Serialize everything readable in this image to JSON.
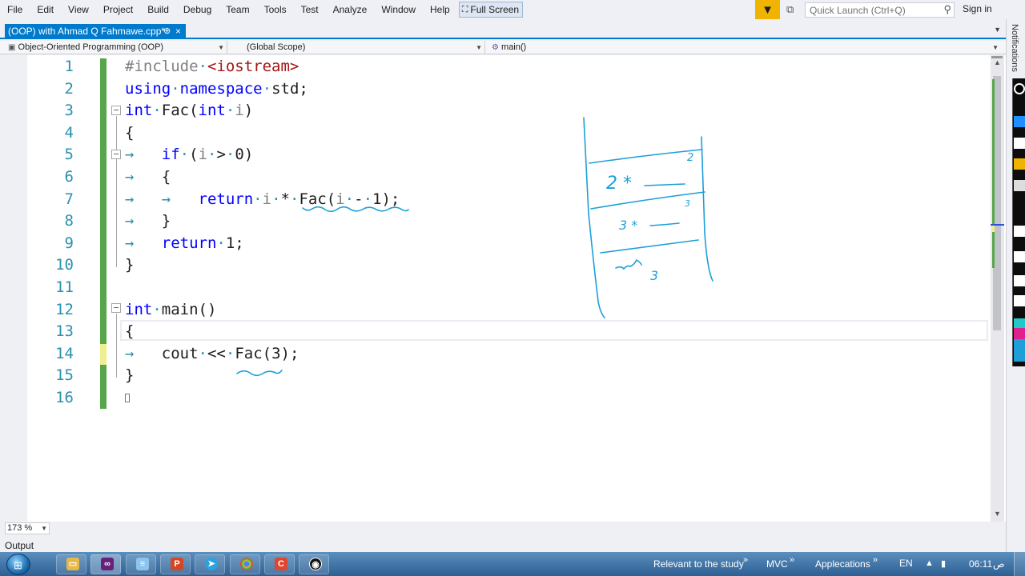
{
  "menu": {
    "items": [
      "File",
      "Edit",
      "View",
      "Project",
      "Build",
      "Debug",
      "Team",
      "Tools",
      "Test",
      "Analyze",
      "Window",
      "Help"
    ],
    "fullscreen_label": "Full Screen"
  },
  "quick_launch": {
    "placeholder": "Quick Launch (Ctrl+Q)"
  },
  "signin_label": "Sign in",
  "document_tab": {
    "title": "(OOP) with Ahmad Q Fahmawe.cpp*",
    "pin": "⊕",
    "close": "×"
  },
  "navbar": {
    "project": "Object-Oriented Programming (OOP)",
    "scope": "(Global Scope)",
    "member": "main()"
  },
  "editor": {
    "line_numbers": [
      "1",
      "2",
      "3",
      "4",
      "5",
      "6",
      "7",
      "8",
      "9",
      "10",
      "11",
      "12",
      "13",
      "14",
      "15",
      "16"
    ],
    "lines": [
      {
        "parts": [
          {
            "t": "#include",
            "c": "pp"
          },
          {
            "t": "·",
            "c": "ws"
          },
          {
            "t": "<iostream>",
            "c": "str"
          }
        ]
      },
      {
        "parts": [
          {
            "t": "using",
            "c": "kw"
          },
          {
            "t": "·",
            "c": "ws"
          },
          {
            "t": "namespace",
            "c": "kw"
          },
          {
            "t": "·",
            "c": "ws"
          },
          {
            "t": "std;",
            "c": ""
          }
        ]
      },
      {
        "parts": [
          {
            "t": "int",
            "c": "kw"
          },
          {
            "t": "·",
            "c": "ws"
          },
          {
            "t": "Fac(",
            "c": ""
          },
          {
            "t": "int",
            "c": "kw"
          },
          {
            "t": "·",
            "c": "ws"
          },
          {
            "t": "i",
            "c": "pp"
          },
          {
            "t": ")",
            "c": ""
          }
        ]
      },
      {
        "parts": [
          {
            "t": "{",
            "c": ""
          }
        ]
      },
      {
        "parts": [
          {
            "t": "→   ",
            "c": "ws"
          },
          {
            "t": "if",
            "c": "kw"
          },
          {
            "t": "·",
            "c": "ws"
          },
          {
            "t": "(",
            "c": ""
          },
          {
            "t": "i",
            "c": "pp"
          },
          {
            "t": "·",
            "c": "ws"
          },
          {
            "t": ">",
            "c": ""
          },
          {
            "t": "·",
            "c": "ws"
          },
          {
            "t": "0)",
            "c": ""
          }
        ]
      },
      {
        "parts": [
          {
            "t": "→   ",
            "c": "ws"
          },
          {
            "t": "{",
            "c": ""
          }
        ]
      },
      {
        "parts": [
          {
            "t": "→   ",
            "c": "ws"
          },
          {
            "t": "→   ",
            "c": "ws"
          },
          {
            "t": "return",
            "c": "kw"
          },
          {
            "t": "·",
            "c": "ws"
          },
          {
            "t": "i",
            "c": "pp"
          },
          {
            "t": "·",
            "c": "ws"
          },
          {
            "t": "*",
            "c": ""
          },
          {
            "t": "·",
            "c": "ws"
          },
          {
            "t": "Fac(",
            "c": ""
          },
          {
            "t": "i",
            "c": "pp"
          },
          {
            "t": "·",
            "c": "ws"
          },
          {
            "t": "-",
            "c": ""
          },
          {
            "t": "·",
            "c": "ws"
          },
          {
            "t": "1);",
            "c": ""
          }
        ]
      },
      {
        "parts": [
          {
            "t": "→   ",
            "c": "ws"
          },
          {
            "t": "}",
            "c": ""
          }
        ]
      },
      {
        "parts": [
          {
            "t": "→   ",
            "c": "ws"
          },
          {
            "t": "return",
            "c": "kw"
          },
          {
            "t": "·",
            "c": "ws"
          },
          {
            "t": "1;",
            "c": ""
          }
        ]
      },
      {
        "parts": [
          {
            "t": "}",
            "c": ""
          }
        ]
      },
      {
        "parts": []
      },
      {
        "parts": [
          {
            "t": "int",
            "c": "kw"
          },
          {
            "t": "·",
            "c": "ws"
          },
          {
            "t": "main()",
            "c": ""
          }
        ]
      },
      {
        "parts": [
          {
            "t": "{",
            "c": ""
          }
        ]
      },
      {
        "parts": [
          {
            "t": "→   ",
            "c": "ws"
          },
          {
            "t": "cout",
            "c": ""
          },
          {
            "t": "·",
            "c": "ws"
          },
          {
            "t": "<<",
            "c": ""
          },
          {
            "t": "·",
            "c": "ws"
          },
          {
            "t": "Fac(3);",
            "c": ""
          }
        ]
      },
      {
        "parts": [
          {
            "t": "}",
            "c": ""
          }
        ]
      },
      {
        "parts": []
      }
    ],
    "annotation": {
      "frame1": "2",
      "frame1_expr": "2 *",
      "frame2": "3",
      "frame2_expr": "3 *",
      "frame3_expr": "3"
    }
  },
  "zoom": {
    "value": "173 %"
  },
  "output_label": "Output",
  "notifications_label": "Notifications",
  "taskbar": {
    "relevant_label": "Relevant to the study",
    "mvc_label": "MVC",
    "applications_label": "Applecations",
    "language": "EN",
    "time": "06:11",
    "ampm": "ص"
  },
  "colors": {
    "accent": "#007acc",
    "filter": "#f0b400",
    "change_saved": "#57a64a",
    "change_unsaved": "#efef8f",
    "ink": "#1e9fd8"
  },
  "icons": [
    "fullscreen-icon",
    "filter-icon",
    "feedback-icon",
    "search-icon",
    "pin-icon",
    "close-icon",
    "fold-icon",
    "windows-start-icon"
  ]
}
